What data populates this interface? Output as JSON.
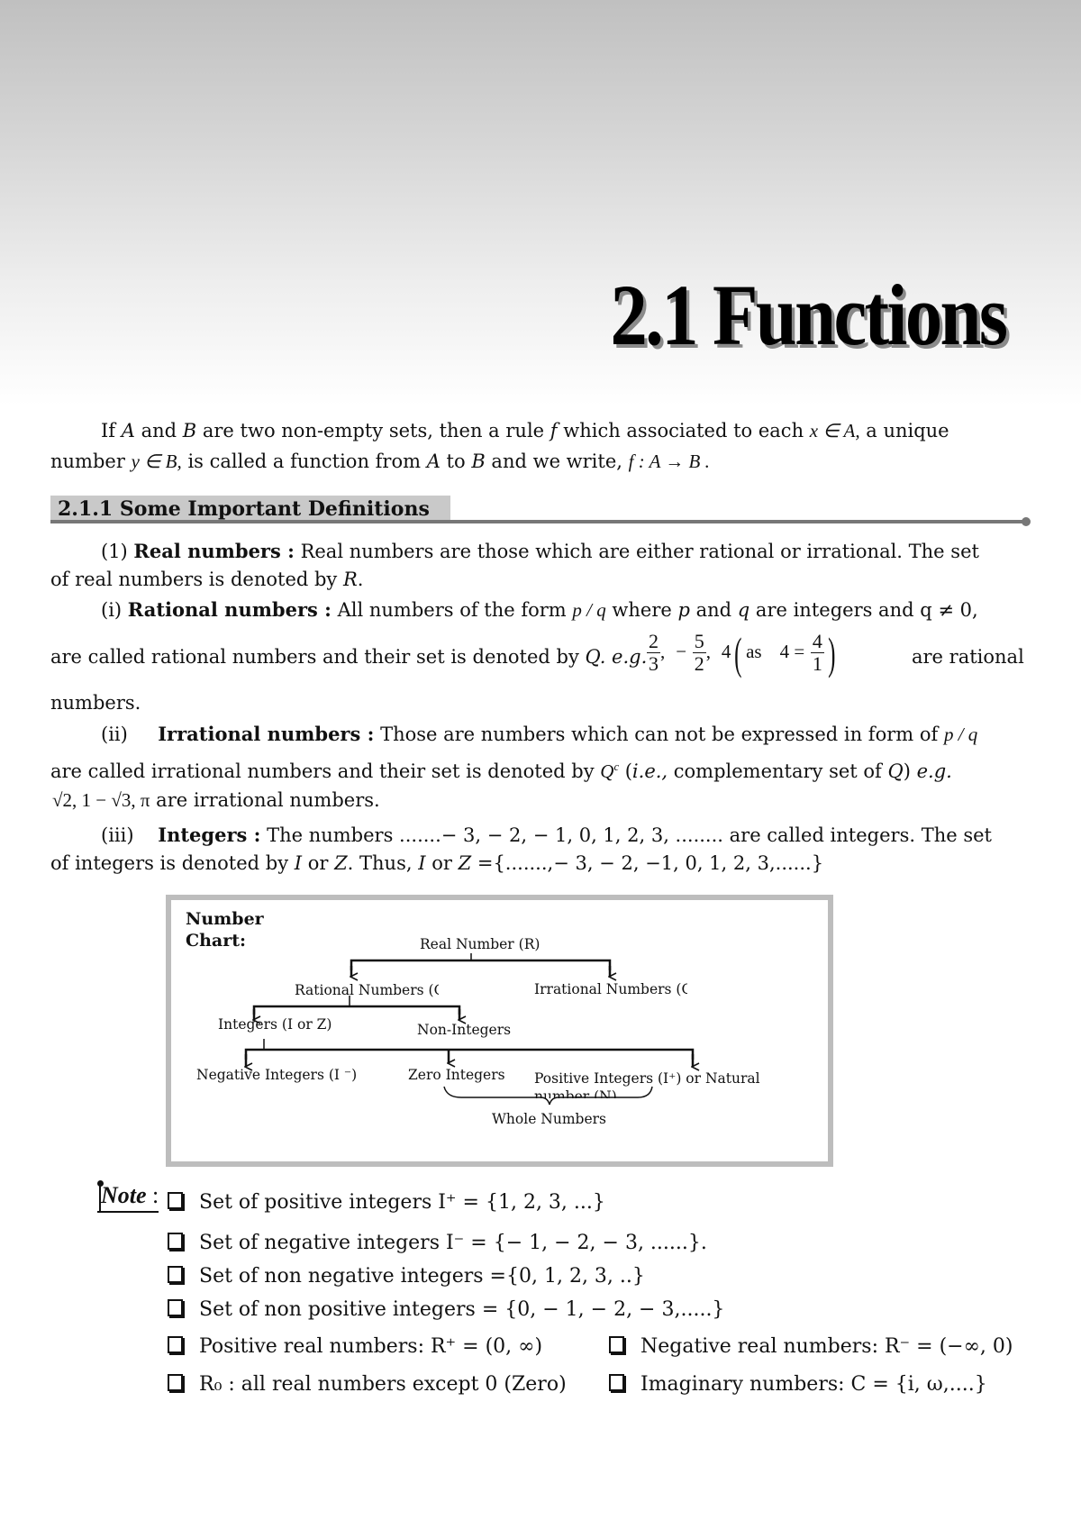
{
  "header": {
    "title": "2.1 Functions"
  },
  "intro": {
    "line1_a": "If ",
    "A": "A",
    "line1_b": " and ",
    "B": "B",
    "line1_c": " are two non-empty sets, then a rule ",
    "f": "f",
    "line1_d": " which associated to each ",
    "x_in_A": "x ∈ A,",
    "line1_e": " a unique",
    "line2_a": "number ",
    "y_in_B": "y ∈ B,",
    "line2_b": " is called a function from ",
    "line2_c": " to ",
    "line2_d": " and we write, ",
    "mapping": "f : A → B ."
  },
  "section": {
    "title": "2.1.1 Some Important Definitions"
  },
  "definitions": {
    "real": {
      "num": "(1) ",
      "term": "Real numbers :",
      "text1": " Real numbers are those which are either rational or irrational. The set",
      "text2": "of real numbers is denoted by ",
      "sym": "R",
      "end": "."
    },
    "rational": {
      "num": "(i) ",
      "term": "Rational numbers :",
      "text1a": " All numbers of the form ",
      "pq": "p / q",
      "text1b": " where ",
      "p": "p",
      "text1c": " and ",
      "q": "q",
      "text1d": " are integers and ",
      "qne0": "q ≠ 0,",
      "text2": "are called rational numbers and their set is denoted by ",
      "Q": "Q",
      "eg": ". e.g.",
      "examples": {
        "f1_num": "2",
        "f1_den": "3",
        "f2_sign": "−",
        "f2_num": "5",
        "f2_den": "2",
        "four": "4",
        "as": "as",
        "four_eq": "4 =",
        "f3_num": "4",
        "f3_den": "1"
      },
      "text2_end": "are rational",
      "text3": "numbers."
    },
    "irrational": {
      "num": "(ii)",
      "term": "Irrational numbers :",
      "text1": " Those are numbers which can not be expressed in form of ",
      "pq": "p / q",
      "text2a": "are called irrational numbers  and their set is denoted by ",
      "Qc": "Q",
      "Qc_sup": "c",
      "text2b": " (",
      "ie": "i.e.,",
      "text2c": " complementary set of ",
      "Q": "Q",
      "text2d": ") ",
      "eg": "e.g.",
      "examples": "√2,  1 − √3,  π",
      "text3": " are  irrational numbers."
    },
    "integers": {
      "num": "(iii)",
      "term": "Integers :",
      "text1": " The numbers .......− 3, − 2, − 1, 0, 1, 2, 3, ........ are called integers. The set",
      "text2a": "of integers is denoted by ",
      "I": "I",
      "or": " or ",
      "Z": "Z",
      "text2b": ". Thus, ",
      "text2c": " =",
      "set": "{.......,− 3, − 2, −1, 0, 1, 2, 3,......}"
    }
  },
  "number_chart": {
    "heading": "Number Chart:",
    "nodes": {
      "real": "Real Number (R)",
      "rational": "Rational Numbers (Q)",
      "irrational": "Irrational Numbers (Q^C)",
      "integers": "Integers (I or Z)",
      "non_integers": "Non-Integers",
      "negative": "Negative Integers (I ⁻)",
      "zero": "Zero Integers",
      "positive": "Positive Integers (I⁺) or Natural number (N)",
      "whole": "Whole Numbers"
    }
  },
  "note": {
    "label": "Note",
    "colon": " :",
    "items": [
      "Set of positive integers I⁺ = {1, 2, 3, ...}",
      "Set of negative integers I⁻ = {− 1, − 2, − 3, ......}.",
      "Set of non negative integers ={0, 1, 2, 3, ..}",
      "Set of non positive integers = {0, − 1, − 2, − 3,.....}",
      "Positive real numbers:  R⁺ = (0, ∞)",
      "Negative real numbers:  R⁻ = (−∞, 0)",
      "R₀ :  all real numbers except 0 (Zero)",
      "Imaginary numbers:  C = {i, ω,....}"
    ]
  }
}
